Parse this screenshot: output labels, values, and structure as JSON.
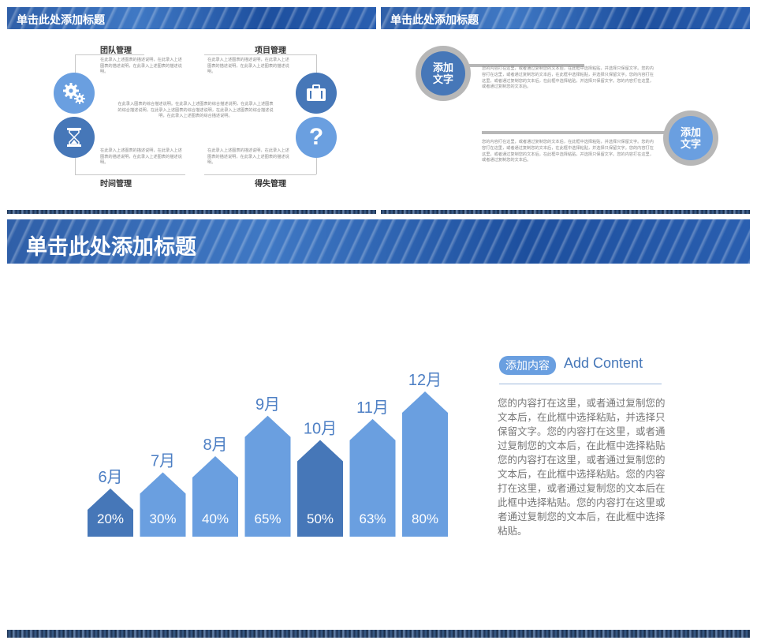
{
  "slide1": {
    "title": "单击此处添加标题",
    "labels": {
      "team": "团队管理",
      "project": "项目管理",
      "time": "时间管理",
      "gain_loss": "得失管理"
    },
    "text_tl": "在此录入上述图表的描述说明，在此录入上述图表的描述说明，在此录入上述图表的描述说明。",
    "text_tr": "在此录入上述图表的描述说明，在此录入上述图表的描述说明，在此录入上述图表的描述说明。",
    "text_center": "在此录入图表的综合描述说明。在此录入上述图表的综合描述说明，在此录入上述图表的综合描述说明，在此录入上述图表的综合描述说明，在此录入上述图表的综合描述说明，在此录入上述图表的综合描述说明。",
    "text_bl": "在此录入上述图表的描述说明，在此录入上述图表的描述说明，在此录入上述图表的描述说明。",
    "text_br": "在此录入上述图表的描述说明，在此录入上述图表的描述说明，在此录入上述图表的描述说明。",
    "icons": [
      "gears-icon",
      "briefcase-icon",
      "hourglass-icon",
      "question-icon"
    ]
  },
  "slide2": {
    "title": "单击此处添加标题",
    "circle1_line1": "添加",
    "circle1_line2": "文字",
    "circle2_line1": "添加",
    "circle2_line2": "文字",
    "text1": "您的内容打在这里，或者通过复制您的文本后，在此框中选择粘贴，并选择只保留文字。您的内容打在这里，或者通过复制您的文本后，在此框中选择粘贴，并选择只保留文字。您的内容打在这里，或者通过复制您的文本后，在此框中选择粘贴，并选择只保留文字。您的内容打在这里，或者通过复制您的文本后。",
    "text2": "您的内容打在这里，或者通过复制您的文本后，在此框中选择粘贴，并选择只保留文字。您的内容打在这里，或者通过复制您的文本后，在此框中选择粘贴，并选择只保留文字。您的内容打在这里，或者通过复制您的文本后，在此框中选择粘贴，并选择只保留文字。您的内容打在这里，或者通过复制您的文本后。"
  },
  "slide3": {
    "title": "单击此处添加标题",
    "badge": "添加内容",
    "heading": "Add Content",
    "body": "您的内容打在这里，或者通过复制您的文本后，在此框中选择粘贴，并选择只保留文字。您的内容打在这里，或者通过复制您的文本后，在此框中选择粘贴您的内容打在这里，或者通过复制您的文本后，在此框中选择粘贴。您的内容打在这里，或者通过复制您的文本后在此框中选择粘贴。您的内容打在这里或者通过复制您的文本后，在此框中选择粘贴。"
  },
  "colors": {
    "dark_blue": "#4677b8",
    "light_blue": "#6a9fe0",
    "grey": "#b7b7b7",
    "text_grey": "#777777"
  },
  "chart_data": {
    "type": "bar",
    "categories": [
      "6月",
      "7月",
      "8月",
      "9月",
      "10月",
      "11月",
      "12月"
    ],
    "values": [
      20,
      30,
      40,
      65,
      50,
      63,
      80
    ],
    "value_labels": [
      "20%",
      "30%",
      "40%",
      "65%",
      "50%",
      "63%",
      "80%"
    ],
    "bar_colors": [
      "#4677b8",
      "#6a9fe0",
      "#6a9fe0",
      "#6a9fe0",
      "#4677b8",
      "#6a9fe0",
      "#6a9fe0"
    ]
  }
}
